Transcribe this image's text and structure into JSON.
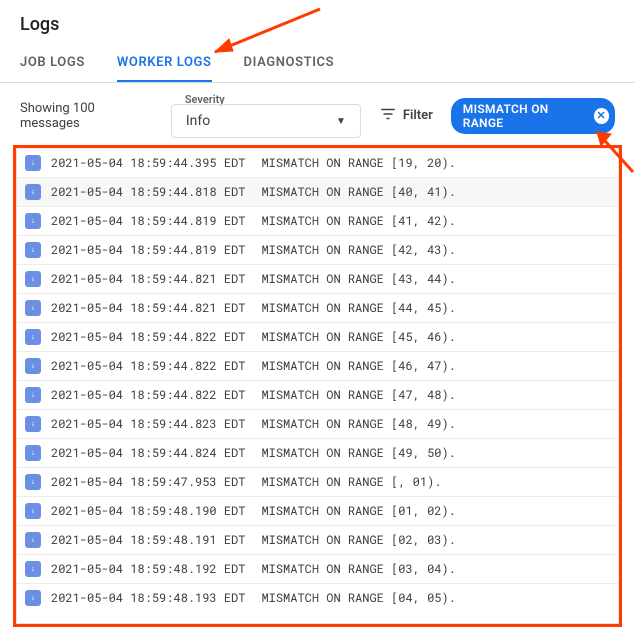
{
  "header": {
    "title": "Logs"
  },
  "tabs": {
    "job_logs": "JOB LOGS",
    "worker_logs": "WORKER LOGS",
    "diagnostics": "DIAGNOSTICS"
  },
  "controls": {
    "showing": "Showing 100 messages",
    "severity_label": "Severity",
    "severity_value": "Info",
    "filter_label": "Filter",
    "chip_text": "MISMATCH ON RANGE"
  },
  "logs": [
    {
      "ts": "2021-05-04 18:59:44.395 EDT",
      "msg": "MISMATCH ON RANGE [19, 20)."
    },
    {
      "ts": "2021-05-04 18:59:44.818 EDT",
      "msg": "MISMATCH ON RANGE [40, 41)."
    },
    {
      "ts": "2021-05-04 18:59:44.819 EDT",
      "msg": "MISMATCH ON RANGE [41, 42)."
    },
    {
      "ts": "2021-05-04 18:59:44.819 EDT",
      "msg": "MISMATCH ON RANGE [42, 43)."
    },
    {
      "ts": "2021-05-04 18:59:44.821 EDT",
      "msg": "MISMATCH ON RANGE [43, 44)."
    },
    {
      "ts": "2021-05-04 18:59:44.821 EDT",
      "msg": "MISMATCH ON RANGE [44, 45)."
    },
    {
      "ts": "2021-05-04 18:59:44.822 EDT",
      "msg": "MISMATCH ON RANGE [45, 46)."
    },
    {
      "ts": "2021-05-04 18:59:44.822 EDT",
      "msg": "MISMATCH ON RANGE [46, 47)."
    },
    {
      "ts": "2021-05-04 18:59:44.822 EDT",
      "msg": "MISMATCH ON RANGE [47, 48)."
    },
    {
      "ts": "2021-05-04 18:59:44.823 EDT",
      "msg": "MISMATCH ON RANGE [48, 49)."
    },
    {
      "ts": "2021-05-04 18:59:44.824 EDT",
      "msg": "MISMATCH ON RANGE [49, 50)."
    },
    {
      "ts": "2021-05-04 18:59:47.953 EDT",
      "msg": "MISMATCH ON RANGE [, 01)."
    },
    {
      "ts": "2021-05-04 18:59:48.190 EDT",
      "msg": "MISMATCH ON RANGE [01, 02)."
    },
    {
      "ts": "2021-05-04 18:59:48.191 EDT",
      "msg": "MISMATCH ON RANGE [02, 03)."
    },
    {
      "ts": "2021-05-04 18:59:48.192 EDT",
      "msg": "MISMATCH ON RANGE [03, 04)."
    },
    {
      "ts": "2021-05-04 18:59:48.193 EDT",
      "msg": "MISMATCH ON RANGE [04, 05)."
    }
  ]
}
